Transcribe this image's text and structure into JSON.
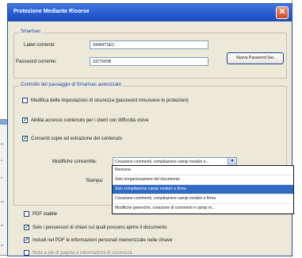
{
  "window": {
    "title": "Protezione Mediante Risorse"
  },
  "sections": {
    "smartsec": {
      "legend": "Smartsec",
      "label_field_label": "Label corrente:",
      "label_field_value": "SMARTSEC",
      "password_label": "Password corrente:",
      "password_value": "SICTRIDB",
      "change_button": "Nuova Password Sec"
    },
    "permissions": {
      "legend": "Controllo del passaggio di Smartsec autorizzato",
      "options": [
        {
          "label": "Modifica delle impostazioni di sicurezza (password rimuovere le protezioni)",
          "checked": false,
          "dim": false
        },
        {
          "label": "Abilita accesso contenuto per i client con difficoltà visive",
          "checked": true,
          "dim": false
        },
        {
          "label": "Consenti copie ed estrazione del contenuto",
          "checked": true,
          "dim": false
        }
      ],
      "changes_label": "Modifiche consentite:",
      "changes_selected": "Creazione commenti, compilazione campi modulo e...",
      "print_label": "Stampa:",
      "dropdown_options": [
        {
          "label": "Nessuna",
          "selected": false
        },
        {
          "label": "Solo riorganizzazione del documento",
          "selected": false
        },
        {
          "label": "Solo compilazione campi modulo e firma",
          "selected": true
        },
        {
          "label": "Creazione commenti, compilazione campi modulo e firma",
          "selected": false
        },
        {
          "label": "Modifiche generiche, creazione di commenti e campi m...",
          "selected": false
        }
      ]
    },
    "bottom": {
      "options": [
        {
          "label": "PDF stabile",
          "checked": false,
          "dim": false
        },
        {
          "label": "Solo i possessori di chiavi sui quali possono aprire il documento",
          "checked": true,
          "dim": false
        },
        {
          "label": "Includi nel PDF le informazioni personali memorizzate nelle chiave",
          "checked": true,
          "dim": false
        },
        {
          "label": "Nota a piè di pagina e informazioni di sicurezza",
          "checked": false,
          "dim": true
        }
      ]
    }
  },
  "background_window": {
    "lines": [
      "Pi",
      "o",
      "d",
      "ee",
      "ie",
      "ia"
    ]
  }
}
